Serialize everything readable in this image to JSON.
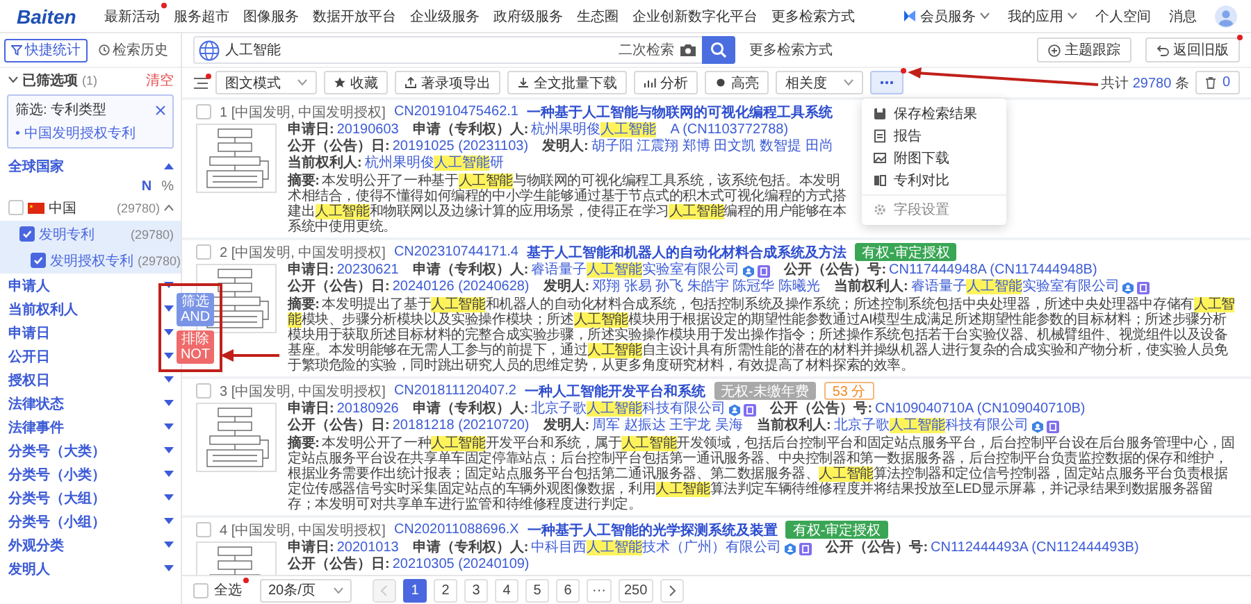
{
  "top_nav": {
    "logo": "Baiten",
    "items": [
      {
        "label": "最新活动",
        "dot": true
      },
      {
        "label": "服务超市",
        "dot": false
      },
      {
        "label": "图像服务",
        "dot": false
      },
      {
        "label": "数据开放平台",
        "dot": false
      },
      {
        "label": "企业级服务",
        "dot": false
      },
      {
        "label": "政府级服务",
        "dot": false
      },
      {
        "label": "生态圈",
        "dot": false
      },
      {
        "label": "企业创新数字化平台",
        "dot": false
      },
      {
        "label": "更多检索方式",
        "dot": false
      }
    ],
    "right": [
      {
        "label": "会员服务",
        "kind": "vip-menu"
      },
      {
        "label": "我的应用",
        "kind": "menu"
      },
      {
        "label": "个人空间",
        "kind": "link"
      },
      {
        "label": "消息",
        "kind": "link"
      }
    ]
  },
  "sidebar": {
    "tabs": [
      {
        "label": "快捷统计",
        "selected": true
      },
      {
        "label": "检索历史",
        "selected": false
      }
    ],
    "selected_header": {
      "title": "已筛选项",
      "count": "(1)",
      "clear": "清空"
    },
    "filter": {
      "label": "筛选: 专利类型",
      "value": "• 中国发明授权专利"
    },
    "country_facet": {
      "title": "全球国家",
      "expanded": true,
      "columns": [
        "N",
        "%"
      ],
      "tree": [
        {
          "label": "中国",
          "count": "(29780)",
          "checked": false,
          "expanded": true,
          "children": [
            {
              "label": "发明专利",
              "count": "(29780)",
              "checked": true,
              "children": [
                {
                  "label": "发明授权专利",
                  "count": "(29780)",
                  "checked": true
                }
              ]
            }
          ]
        }
      ]
    },
    "facets": [
      {
        "label": "申请人",
        "expanded": false
      },
      {
        "label": "当前权利人",
        "expanded": false
      },
      {
        "label": "申请日",
        "expanded": false
      },
      {
        "label": "公开日",
        "expanded": false
      },
      {
        "label": "授权日",
        "expanded": false
      },
      {
        "label": "法律状态",
        "expanded": false
      },
      {
        "label": "法律事件",
        "expanded": false
      },
      {
        "label": "分类号（大类）",
        "expanded": false
      },
      {
        "label": "分类号（小类）",
        "expanded": false
      },
      {
        "label": "分类号（大组）",
        "expanded": false
      },
      {
        "label": "分类号（小组）",
        "expanded": false
      },
      {
        "label": "外观分类",
        "expanded": false
      },
      {
        "label": "发明人",
        "expanded": false
      }
    ]
  },
  "search": {
    "value": "人工智能",
    "secondary": "二次检索",
    "more_link": "更多检索方式",
    "buttons": [
      {
        "label": "主题跟踪",
        "dot": false
      },
      {
        "label": "返回旧版",
        "dot": true
      }
    ]
  },
  "toolbar": {
    "list_dot": true,
    "items": [
      {
        "kind": "select",
        "label": "图文模式"
      },
      {
        "kind": "button",
        "label": "收藏"
      },
      {
        "kind": "button",
        "label": "著录项导出"
      },
      {
        "kind": "button",
        "label": "全文批量下载"
      },
      {
        "kind": "button",
        "label": "分析"
      },
      {
        "kind": "button",
        "label": "高亮"
      },
      {
        "kind": "select",
        "label": "相关度"
      },
      {
        "kind": "more",
        "open": true,
        "dot": true,
        "annotation_arrow": true
      }
    ],
    "menu": [
      [
        "保存检索结果",
        "报告",
        "附图下载",
        "专利对比"
      ],
      [
        "字段设置"
      ]
    ],
    "total": {
      "prefix": "共计",
      "count": "29780",
      "suffix": "条"
    },
    "trash_count": "0"
  },
  "results": [
    {
      "index": "1",
      "checked": false,
      "types": "[中国发明, 中国发明授权]",
      "number": "CN201910475462.1",
      "title": "一种基于人工智能与物联网的可视化编程工具系统",
      "fields": [
        {
          "label": "申请日:",
          "value": "20190603",
          "marks": false
        },
        {
          "label": "申请（专利权）人:",
          "value": [
            {
              "text": "杭州果明俊",
              "highlight": false
            },
            {
              "text": "人工智能",
              "highlight": true
            }
          ],
          "marks": false
        },
        {
          "value": "A (CN1103772788)",
          "marks": false
        },
        {
          "label": "公开（公告）日:",
          "value": "20191025 (20231103)",
          "marks": false
        },
        {
          "label": "发明人:",
          "value": "胡子阳 江震翔 郑博 田文凯 数智提 田尚",
          "marks": false
        },
        {
          "label": "当前权利人:",
          "value": [
            {
              "text": "杭州果明俊",
              "highlight": false
            },
            {
              "text": "人工智能",
              "highlight": true
            },
            {
              "text": "研",
              "highlight": false
            }
          ],
          "marks": false
        }
      ],
      "abstract_label": "摘要:",
      "abstract": [
        {
          "text": "本发明公开了一种基于",
          "highlight": false
        },
        {
          "text": "人工智能",
          "highlight": true
        },
        {
          "text": "与物联网的可视化编程工具系统，该系统包括。本发明术相结合，使得不懂得如何编程的中小学生能够通过基于节点式的积木式可视化编程的方式搭建出",
          "highlight": false
        },
        {
          "text": "人工智能",
          "highlight": true
        },
        {
          "text": "和物联网以及边缘计算的应用场景，使得正在学习",
          "highlight": false
        },
        {
          "text": "人工智能",
          "highlight": true
        },
        {
          "text": "编程的用户能够在本系统中使用更统。",
          "highlight": false
        }
      ]
    },
    {
      "index": "2",
      "checked": false,
      "types": "[中国发明, 中国发明授权]",
      "number": "CN202310744171.4",
      "title": "基于人工智能和机器人的自动化材料合成系统及方法",
      "badges": [
        {
          "text": "有权-审定授权",
          "kind": "valid"
        }
      ],
      "fields": [
        {
          "label": "申请日:",
          "value": "20230621",
          "marks": false
        },
        {
          "label": "申请（专利权）人:",
          "value": [
            {
              "text": "睿语量子",
              "highlight": false
            },
            {
              "text": "人工智能",
              "highlight": true
            },
            {
              "text": "实验室有限公司",
              "highlight": false
            }
          ],
          "marks": true
        },
        {
          "label": "公开（公告）号:",
          "value": "CN117444948A (CN117444948B)",
          "marks": false
        },
        {
          "label": "公开（公告）日:",
          "value": "20240126 (20240628)",
          "marks": false
        },
        {
          "label": "发明人:",
          "value": "邓翔 张易 孙飞 朱皓宇 陈冠华 陈曦光",
          "marks": false
        },
        {
          "label": "当前权利人:",
          "value": [
            {
              "text": "睿语量子",
              "highlight": false
            },
            {
              "text": "人工智能",
              "highlight": true
            },
            {
              "text": "实验室有限公司",
              "highlight": false
            }
          ],
          "marks": true
        }
      ],
      "abstract_label": "摘要:",
      "abstract": [
        {
          "text": "本发明提出了基于",
          "highlight": false
        },
        {
          "text": "人工智能",
          "highlight": true
        },
        {
          "text": "和机器人的自动化材料合成系统，包括控制系统及操作系统；所述控制系统包括中央处理器，所述中央处理器中存储有",
          "highlight": false
        },
        {
          "text": "人工智能",
          "highlight": true
        },
        {
          "text": "模块、步骤分析模块以及实验操作模块；所述",
          "highlight": false
        },
        {
          "text": "人工智能",
          "highlight": true
        },
        {
          "text": "模块用于根据设定的期望性能参数通过AI模型生成满足所述期望性能参数的目标材料；所述步骤分析模块用于获取所述目标材料的完整合成实验步骤，所述实验操作模块用于发出操作指令；所述操作系统包括若干台实验仪器、机械臂组件、视觉组件以及设备基座。本发明能够在无需人工参与的前提下，通过",
          "highlight": false
        },
        {
          "text": "人工智能",
          "highlight": true
        },
        {
          "text": "自主设计具有所需性能的潜在的材料并操纵机器人进行复杂的合成实验和产物分析，使实验人员免于繁琐危险的实验，同时跳出研究人员的思维定势，从更多角度研究材料，有效提高了材料探索的效率。",
          "highlight": false
        }
      ]
    },
    {
      "index": "3",
      "checked": false,
      "types": "[中国发明, 中国发明授权]",
      "number": "CN201811120407.2",
      "title": "一种人工智能开发平台和系统",
      "badges": [
        {
          "text": "无权-未缴年费",
          "kind": "invalid"
        },
        {
          "text": "53 分",
          "kind": "score"
        }
      ],
      "fields": [
        {
          "label": "申请日:",
          "value": "20180926",
          "marks": false
        },
        {
          "label": "申请（专利权）人:",
          "value": [
            {
              "text": "北京子歌",
              "highlight": false
            },
            {
              "text": "人工智能",
              "highlight": true
            },
            {
              "text": "科技有限公司",
              "highlight": false
            }
          ],
          "marks": true
        },
        {
          "label": "公开（公告）号:",
          "value": "CN109040710A (CN109040710B)",
          "marks": false
        },
        {
          "label": "公开（公告）日:",
          "value": "20181218 (20210720)",
          "marks": false
        },
        {
          "label": "发明人:",
          "value": "周军 赵振达 王宇龙 吴海",
          "marks": false
        },
        {
          "label": "当前权利人:",
          "value": [
            {
              "text": "北京子歌",
              "highlight": false
            },
            {
              "text": "人工智能",
              "highlight": true
            },
            {
              "text": "科技有限公司",
              "highlight": false
            }
          ],
          "marks": true
        }
      ],
      "abstract_label": "摘要:",
      "abstract": [
        {
          "text": "本发明公开了一种",
          "highlight": false
        },
        {
          "text": "人工智能",
          "highlight": true
        },
        {
          "text": "开发平台和系统，属于",
          "highlight": false
        },
        {
          "text": "人工智能",
          "highlight": true
        },
        {
          "text": "开发领域，包括后台控制平台和固定站点服务平台，后台控制平台设在后台服务管理中心，固定站点服务平台设在共享单车固定停靠站点；后台控制平台包括第一通讯服务器、中央控制器和第一数据服务器，后台控制平台负责监控数据的保存和维护，根据业务需要作出统计报表；固定站点服务平台包括第二通讯服务器、第二数据服务器、",
          "highlight": false
        },
        {
          "text": "人工智能",
          "highlight": true
        },
        {
          "text": "算法控制器和定位信号控制器，固定站点服务平台负责根据定位传感器信号实时采集固定站点的车辆外观图像数据，利用",
          "highlight": false
        },
        {
          "text": "人工智能",
          "highlight": true
        },
        {
          "text": "算法判定车辆待维修程度并将结果投放至LED显示屏幕，并记录结果到数据服务器留存；本发明可对共享单车进行监管和待维修程度进行判定。",
          "highlight": false
        }
      ]
    },
    {
      "index": "4",
      "checked": false,
      "types": "[中国发明, 中国发明授权]",
      "number": "CN202011088696.X",
      "title": "一种基于人工智能的光学探测系统及装置",
      "badges": [
        {
          "text": "有权-审定授权",
          "kind": "valid"
        }
      ],
      "fields": [
        {
          "label": "申请日:",
          "value": "20201013",
          "marks": false
        },
        {
          "label": "申请（专利权）人:",
          "value": [
            {
              "text": "中科目西",
              "highlight": false
            },
            {
              "text": "人工智能",
              "highlight": true
            },
            {
              "text": "技术（广州）有限公司",
              "highlight": false
            }
          ],
          "marks": true
        },
        {
          "label": "公开（公告）号:",
          "value": "CN112444493A (CN112444493B)",
          "marks": false
        },
        {
          "label": "公开（公告）日:",
          "value": "20210305 (20240109)",
          "marks": false
        }
      ]
    }
  ],
  "pager": {
    "select_all": {
      "label": "全选",
      "checked": false,
      "dot": true
    },
    "page_size": "20条/页",
    "prev_disabled": true,
    "pages": [
      {
        "label": "1",
        "selected": true
      },
      {
        "label": "2",
        "selected": false
      },
      {
        "label": "3",
        "selected": false
      },
      {
        "label": "4",
        "selected": false
      },
      {
        "label": "5",
        "selected": false
      },
      {
        "label": "6",
        "selected": false
      },
      {
        "label": "···",
        "selected": false
      },
      {
        "label": "250",
        "selected": false
      }
    ]
  },
  "filter_popup": {
    "annotated": true,
    "buttons": [
      {
        "label": "筛选",
        "sub": "AND",
        "kind": "and"
      },
      {
        "label": "排除",
        "sub": "NOT",
        "kind": "not"
      }
    ]
  }
}
